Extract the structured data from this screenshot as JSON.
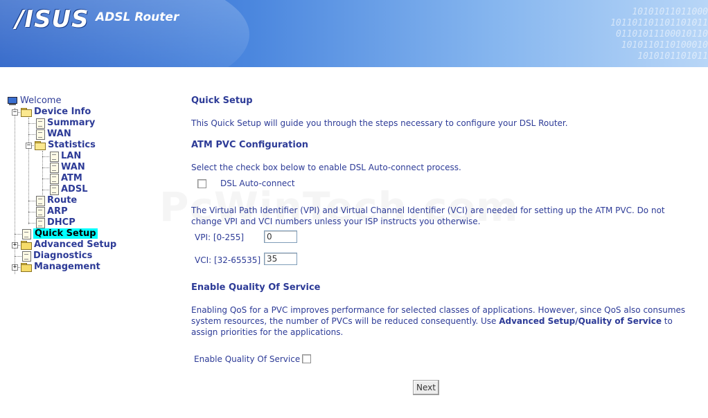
{
  "header": {
    "logo_text": "/ISUS",
    "product_name": "ADSL Router",
    "binary_pattern": "10101011011000\n101101101101101011\n01101011100010110\n1010110110100010\n1010101101011"
  },
  "sidebar": {
    "welcome": "Welcome",
    "device_info": "Device Info",
    "summary": "Summary",
    "wan": "WAN",
    "statistics": "Statistics",
    "stats_lan": "LAN",
    "stats_wan": "WAN",
    "stats_atm": "ATM",
    "stats_adsl": "ADSL",
    "route": "Route",
    "arp": "ARP",
    "dhcp": "DHCP",
    "quick_setup": "Quick Setup",
    "advanced_setup": "Advanced Setup",
    "diagnostics": "Diagnostics",
    "management": "Management"
  },
  "main": {
    "title": "Quick Setup",
    "intro": "This Quick Setup will guide you through the steps necessary to configure your DSL Router.",
    "atm_heading": "ATM PVC Configuration",
    "autoconnect_instruction": "Select the check box below to enable DSL Auto-connect process.",
    "autoconnect_label": "DSL Auto-connect",
    "autoconnect_checked": false,
    "vpi_vci_text_1": "The Virtual Path Identifier (VPI) and Virtual Channel Identifier (VCI) are needed for setting up the ATM PVC. Do not",
    "vpi_vci_text_2": "change VPI and VCI numbers unless your ISP instructs you otherwise.",
    "vpi_label": "VPI: [0-255]",
    "vpi_value": "0",
    "vci_label": "VCI: [32-65535]",
    "vci_value": "35",
    "qos_heading": "Enable Quality Of Service",
    "qos_text_1": "Enabling QoS for a PVC improves performance for selected classes of applications. However, since QoS also consumes",
    "qos_text_2a": "system resources, the number of PVCs will be reduced consequently. Use ",
    "qos_text_2b": "Advanced Setup/Quality of Service",
    "qos_text_2c": " to",
    "qos_text_3": "assign priorities for the applications.",
    "qos_label": "Enable Quality Of Service",
    "qos_checked": false,
    "next_button": "Next"
  },
  "watermark": "PcWinTech.com",
  "colors": {
    "text": "#2d3b97",
    "selected_highlight": "#00ffff",
    "banner_dark": "#2c63c8",
    "banner_light": "#b8d6f7"
  }
}
